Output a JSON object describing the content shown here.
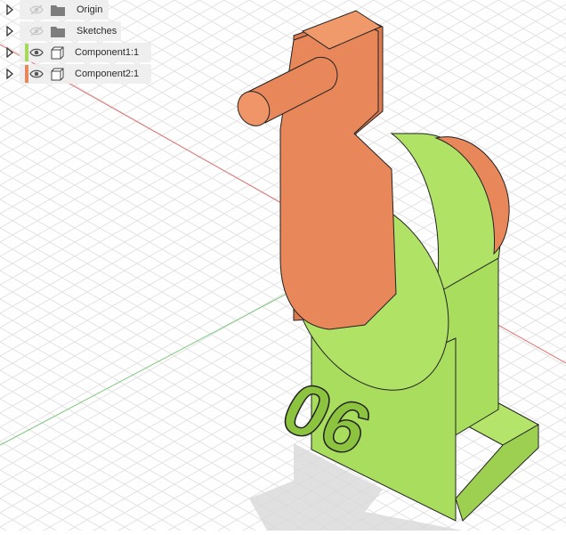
{
  "browser": {
    "items": [
      {
        "label": "Origin",
        "kind": "folder",
        "visible": false,
        "swatch": null
      },
      {
        "label": "Sketches",
        "kind": "folder",
        "visible": false,
        "swatch": null
      },
      {
        "label": "Component1:1",
        "kind": "component",
        "visible": true,
        "swatch": "#a6d85a"
      },
      {
        "label": "Component2:1",
        "kind": "component",
        "visible": true,
        "swatch": "#e8875a"
      }
    ]
  },
  "model": {
    "engraving": "06"
  },
  "colors": {
    "green": "#a9dd5e",
    "orange": "#e8875a",
    "grid_line": "#e3e3e3",
    "axis_x": "#e06060",
    "axis_y": "#66c066"
  }
}
